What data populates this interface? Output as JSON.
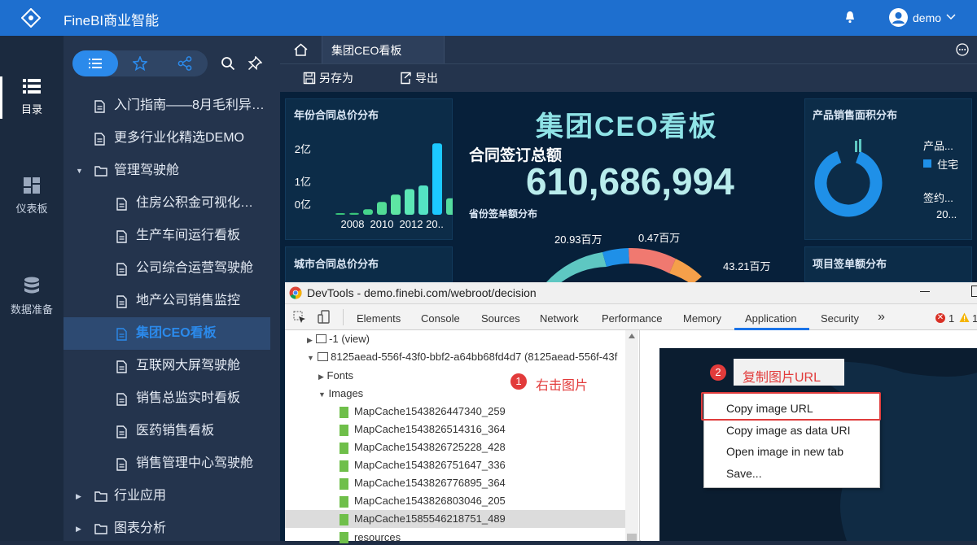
{
  "app": {
    "title": "FineBI商业智能",
    "user": "demo"
  },
  "rail": {
    "items": [
      {
        "label": "目录"
      },
      {
        "label": "仪表板"
      },
      {
        "label": "数据准备"
      }
    ]
  },
  "tree": {
    "items": [
      {
        "label": "入门指南——8月毛利异…",
        "type": "doc"
      },
      {
        "label": "更多行业化精选DEMO",
        "type": "doc"
      },
      {
        "label": "管理驾驶舱",
        "type": "folder-open"
      },
      {
        "label": "住房公积金可视化…",
        "type": "doc"
      },
      {
        "label": "生产车间运行看板",
        "type": "doc"
      },
      {
        "label": "公司综合运营驾驶舱",
        "type": "doc"
      },
      {
        "label": "地产公司销售监控",
        "type": "doc"
      },
      {
        "label": "集团CEO看板",
        "type": "doc",
        "active": true
      },
      {
        "label": "互联网大屏驾驶舱",
        "type": "doc"
      },
      {
        "label": "销售总监实时看板",
        "type": "doc"
      },
      {
        "label": "医药销售看板",
        "type": "doc"
      },
      {
        "label": "销售管理中心驾驶舱",
        "type": "doc"
      },
      {
        "label": "行业应用",
        "type": "folder-closed"
      },
      {
        "label": "图表分析",
        "type": "folder-closed"
      }
    ]
  },
  "tabs": {
    "active": "集团CEO看板"
  },
  "toolbar": {
    "save_as": "另存为",
    "export": "导出"
  },
  "dashboard": {
    "title": "集团CEO看板",
    "contract_label": "合同签订总额",
    "contract_total": "610,686,994",
    "province_label": "省份签单额分布",
    "panels": {
      "year": "年份合同总价分布",
      "city": "城市合同总价分布",
      "product": "产品销售面积分布",
      "project": "项目签单额分布"
    },
    "year_ticks": [
      "2亿",
      "1亿",
      "0亿"
    ],
    "year_axis": [
      "2008",
      "2010",
      "2012",
      "20.."
    ],
    "year_values": [
      0.03,
      0.05,
      0.15,
      0.35,
      0.55,
      0.7,
      0.8,
      1.95,
      0.45
    ],
    "donut_labels": {
      "a": "产品...",
      "b": "住宅",
      "c": "签约...",
      "d": "20..."
    },
    "pie_labels": [
      "20.93百万",
      "0.47百万",
      "43.21百万"
    ]
  },
  "devtools": {
    "title": "DevTools - demo.finebi.com/webroot/decision",
    "tabs": [
      "Elements",
      "Console",
      "Sources",
      "Network",
      "Performance",
      "Memory",
      "Application",
      "Security"
    ],
    "active_tab": "Application",
    "error_count": "1",
    "warn_count": "1",
    "rows": {
      "view": "-1 (view)",
      "frame": "8125aead-556f-43f0-bbf2-a64bb68fd4d7 (8125aead-556f-43f",
      "fonts": "Fonts",
      "images": "Images",
      "resources": "resources"
    },
    "images": [
      "MapCache1543826447340_259",
      "MapCache1543826514316_364",
      "MapCache1543826725228_428",
      "MapCache1543826751647_336",
      "MapCache1543826776895_364",
      "MapCache1543826803046_205",
      "MapCache1585546218751_489"
    ],
    "context_menu": [
      "Copy image URL",
      "Copy image as data URI",
      "Open image in new tab",
      "Save..."
    ]
  },
  "annotations": {
    "step1_num": "1",
    "step1": "右击图片",
    "step2_num": "2",
    "step2": "复制图片URL"
  },
  "colors": {
    "brand": "#1e6fcf",
    "accent": "#2b8aeb",
    "annotation": "#e23b3b"
  }
}
